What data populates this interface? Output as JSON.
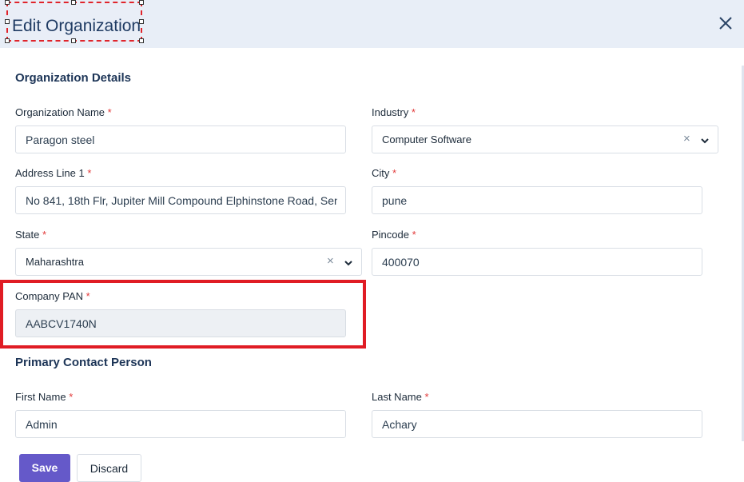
{
  "dialog": {
    "title": "Edit Organization",
    "close_icon": "close-icon"
  },
  "org_section": {
    "title": "Organization Details",
    "org_name": {
      "label": "Organization Name",
      "value": "Paragon steel"
    },
    "industry": {
      "label": "Industry",
      "value": "Computer Software"
    },
    "address1": {
      "label": "Address Line 1",
      "value": "No 841, 18th Flr, Jupiter Mill Compound Elphinstone Road, Sen"
    },
    "city": {
      "label": "City",
      "value": "pune"
    },
    "state": {
      "label": "State",
      "value": "Maharashtra"
    },
    "pincode": {
      "label": "Pincode",
      "value": "400070"
    },
    "pan": {
      "label": "Company PAN",
      "value": "AABCV1740N"
    }
  },
  "contact_section": {
    "title": "Primary Contact Person",
    "first_name": {
      "label": "First Name",
      "value": "Admin"
    },
    "last_name": {
      "label": "Last Name",
      "value": "Achary"
    }
  },
  "required_mark": "*",
  "clear_glyph": "×",
  "actions": {
    "save_label": "Save",
    "discard_label": "Discard"
  },
  "colors": {
    "accent": "#6559c9",
    "highlight": "#e01c24",
    "required": "#e23a3a",
    "header_bg": "#e8eef7"
  }
}
